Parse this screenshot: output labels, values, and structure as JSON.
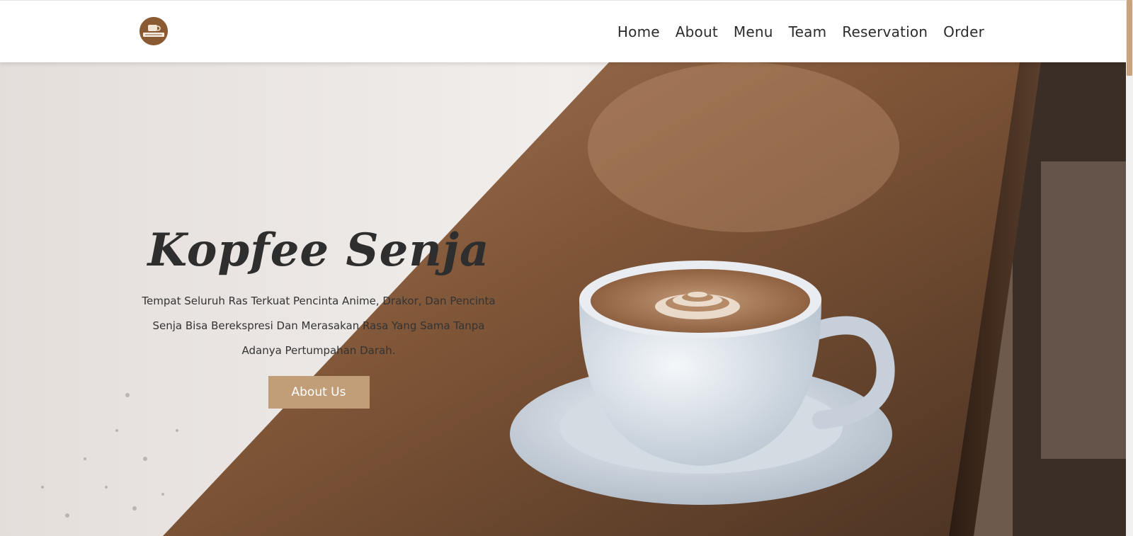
{
  "brand": {
    "logo_icon": "coffee-cup-logo-icon",
    "logo_text": "Kopfee Senja",
    "accent_color": "#c29e78",
    "logo_color": "#8a5a33"
  },
  "nav": {
    "items": [
      {
        "label": "Home"
      },
      {
        "label": "About"
      },
      {
        "label": "Menu"
      },
      {
        "label": "Team"
      },
      {
        "label": "Reservation"
      },
      {
        "label": "Order"
      }
    ]
  },
  "hero": {
    "title": "Kopfee Senja",
    "description": "Tempat Seluruh Ras Terkuat Pencinta Anime, Drakor, Dan Pencinta Senja Bisa Berekspresi Dan Merasakan Rasa Yang Sama Tanpa Adanya Pertumpahan Darah.",
    "button_label": "About Us",
    "background_image": "latte-cup-on-wooden-table"
  }
}
